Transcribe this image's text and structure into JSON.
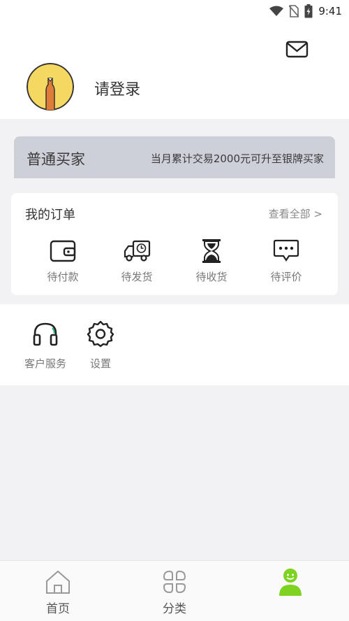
{
  "status_bar": {
    "time": "9:41"
  },
  "profile": {
    "login_prompt": "请登录"
  },
  "member": {
    "level": "普通买家",
    "upgrade_tip": "当月累计交易2000元可升至银牌买家"
  },
  "orders": {
    "title": "我的订单",
    "view_all": "查看全部 >",
    "items": [
      {
        "label": "待付款",
        "icon": "wallet-icon"
      },
      {
        "label": "待发货",
        "icon": "truck-icon"
      },
      {
        "label": "待收货",
        "icon": "hourglass-icon"
      },
      {
        "label": "待评价",
        "icon": "chat-bubble-icon"
      }
    ]
  },
  "services": [
    {
      "label": "客户服务",
      "icon": "headphones-icon"
    },
    {
      "label": "设置",
      "icon": "gear-icon"
    }
  ],
  "tabs": [
    {
      "label": "首页",
      "icon": "home-icon"
    },
    {
      "label": "分类",
      "icon": "grid-icon"
    },
    {
      "label": "",
      "icon": "person-icon"
    }
  ],
  "colors": {
    "member_card_bg": "#cdd0d9",
    "page_bg": "#f2f2f4",
    "active_tab": "#7ed321",
    "avatar_bg": "#f5d862"
  }
}
